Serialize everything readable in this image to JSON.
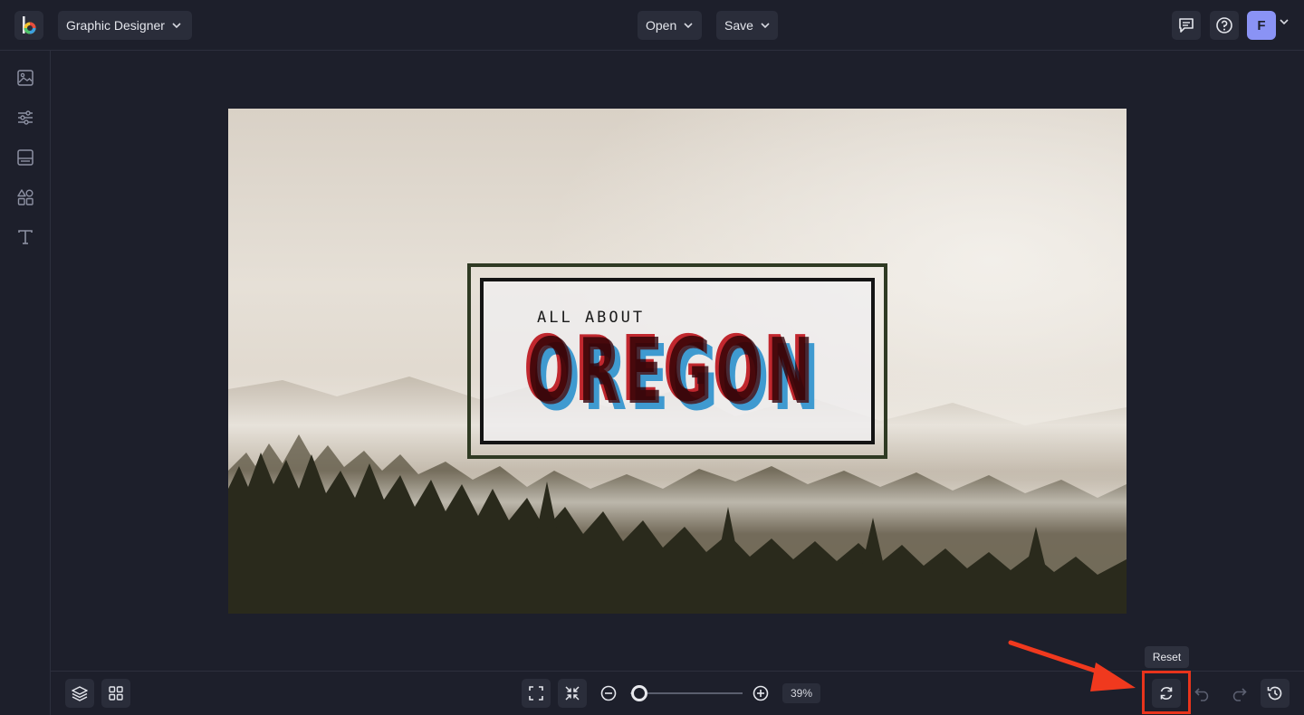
{
  "header": {
    "app_selector": "Graphic Designer",
    "open_label": "Open",
    "save_label": "Save",
    "avatar_initial": "F"
  },
  "sidebar": {
    "items": [
      {
        "icon": "image-icon"
      },
      {
        "icon": "sliders-icon"
      },
      {
        "icon": "layout-icon"
      },
      {
        "icon": "shapes-icon"
      },
      {
        "icon": "text-icon"
      }
    ]
  },
  "canvas": {
    "tagline": "ALL ABOUT",
    "title": "OREGON"
  },
  "footer": {
    "zoom": "39%",
    "tooltip": "Reset"
  },
  "colors": {
    "background": "#1d1f2b",
    "panel": "#2a2d3a",
    "accent": "#8a93f5",
    "highlight": "#e8341c"
  }
}
